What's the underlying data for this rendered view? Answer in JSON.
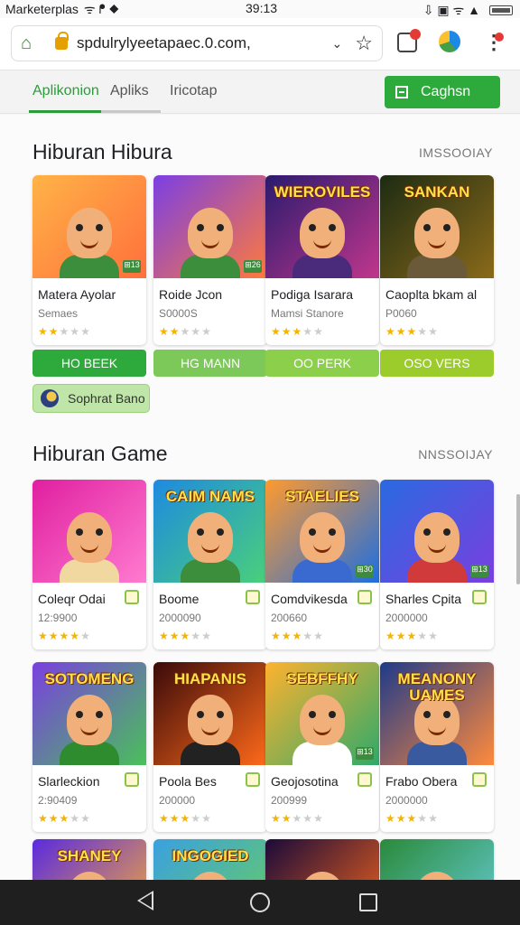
{
  "status_bar": {
    "app_name": "Marketerplas",
    "time": "39:13",
    "left_glyphs": "ᯤ  ᖰ ◆",
    "right_glyphs": "⇩ ▣ ᯤ ▲"
  },
  "browser": {
    "url": "spdulrylyeetapaec.0.com,",
    "chevron": "⌄",
    "bookmark": "☆",
    "menu": "⋮"
  },
  "tabs": [
    {
      "label": "Aplikonion",
      "active": true
    },
    {
      "label": "Apliks",
      "active": false
    },
    {
      "label": "Iricotap",
      "active": false
    }
  ],
  "cta": {
    "label": "Caghsn"
  },
  "section1": {
    "title": "Hiburan Hibura",
    "more": "IMSSOOIAY",
    "cards": [
      {
        "name": "Matera Ayolar",
        "sub": "Semaes",
        "rating": 2,
        "art": "",
        "bg": "linear-gradient(135deg,#ffb347,#ff6f3c)",
        "body": "#3c8d3c",
        "badge": "⊞13"
      },
      {
        "name": "Roide Jcon",
        "sub": "S0000S",
        "rating": 2,
        "art": "",
        "bg": "linear-gradient(135deg,#7b3fe4,#ff7a3c)",
        "body": "#3c8d3c",
        "badge": "⊞26"
      },
      {
        "name": "Podiga Isarara",
        "sub": "Mamsi  Stanore",
        "rating": 3,
        "art": "WIEROVILES",
        "bg": "linear-gradient(135deg,#2a1b6e,#c0368c)",
        "body": "#4a2a7a",
        "badge": ""
      },
      {
        "name": "Caoplta bkam al",
        "sub": "P0060",
        "rating": 3,
        "art": "SANKAN",
        "bg": "linear-gradient(135deg,#1d2b12,#8a6a1a)",
        "body": "#6a5a3a",
        "badge": ""
      }
    ],
    "pills": [
      {
        "label": "HO BEEK",
        "color": "#2eaa3c"
      },
      {
        "label": "HG MANN",
        "color": "#7cc95a"
      },
      {
        "label": "OO PERK",
        "color": "#8ccf4a"
      },
      {
        "label": "OSO VERS",
        "color": "#9ccb2c"
      }
    ],
    "chip": "Sophrat Bano"
  },
  "section2": {
    "title": "Hiburan Game",
    "more": "NNSSOIJAY",
    "cards": [
      {
        "name": "Coleqr Odai",
        "sub": "12:9900",
        "rating": 4,
        "art": "",
        "bg": "linear-gradient(135deg,#e01fa0,#ff7bd0)",
        "body": "#f0d8a0",
        "badge": ""
      },
      {
        "name": "Boome",
        "sub": "2000090",
        "rating": 3,
        "art": "CAIM NAMS",
        "bg": "linear-gradient(135deg,#1e8ae0,#4ad07a)",
        "body": "#3c8d3c",
        "badge": ""
      },
      {
        "name": "Comdvikesda",
        "sub": "200660",
        "rating": 3,
        "art": "STAELIES",
        "bg": "linear-gradient(135deg,#ff9a2e,#1e6ee0)",
        "body": "#3a6ad0",
        "badge": "⊞30"
      },
      {
        "name": "Sharles Cpita",
        "sub": "2000000",
        "rating": 3,
        "art": "",
        "bg": "linear-gradient(135deg,#2a6ae0,#7a3fe0)",
        "body": "#d03a3a",
        "badge": "⊞13"
      },
      {
        "name": "Slarleckion",
        "sub": "2:90409",
        "rating": 3,
        "art": "SOTOMENG",
        "bg": "linear-gradient(135deg,#7a3fe0,#4ac05a)",
        "body": "#2e8b2e",
        "badge": ""
      },
      {
        "name": "Poola Bes",
        "sub": "200000",
        "rating": 3,
        "art": "HIAPANIS",
        "bg": "linear-gradient(135deg,#3a0a0a,#ff6a1a)",
        "body": "#222222",
        "badge": ""
      },
      {
        "name": "Geojosotina",
        "sub": "200999",
        "rating": 2,
        "art": "SEBFFHY",
        "bg": "linear-gradient(135deg,#ffb22e,#2eaa6a)",
        "body": "#ffffff",
        "badge": "⊞13"
      },
      {
        "name": "Frabo Obera",
        "sub": "2000000",
        "rating": 3,
        "art": "MEANONY UAMES",
        "bg": "linear-gradient(135deg,#1e3a8a,#ff8a3c)",
        "body": "#3a5aa0",
        "badge": ""
      },
      {
        "name": "",
        "sub": "",
        "rating": 0,
        "art": "SHANEY",
        "bg": "linear-gradient(135deg,#5a2ae0,#ffb22e)",
        "body": "#d03a3a",
        "badge": ""
      },
      {
        "name": "",
        "sub": "",
        "rating": 0,
        "art": "INGOGIED",
        "bg": "linear-gradient(135deg,#3aa0e0,#6ad05a)",
        "body": "#e0a03a",
        "badge": ""
      },
      {
        "name": "",
        "sub": "",
        "rating": 0,
        "art": "",
        "bg": "linear-gradient(135deg,#1a0a3a,#ff6a1a)",
        "body": "#7a3a1a",
        "badge": ""
      },
      {
        "name": "",
        "sub": "",
        "rating": 0,
        "art": "",
        "bg": "linear-gradient(135deg,#2a8a3a,#6ad0e0)",
        "body": "#c07a3a",
        "badge": ""
      }
    ]
  }
}
